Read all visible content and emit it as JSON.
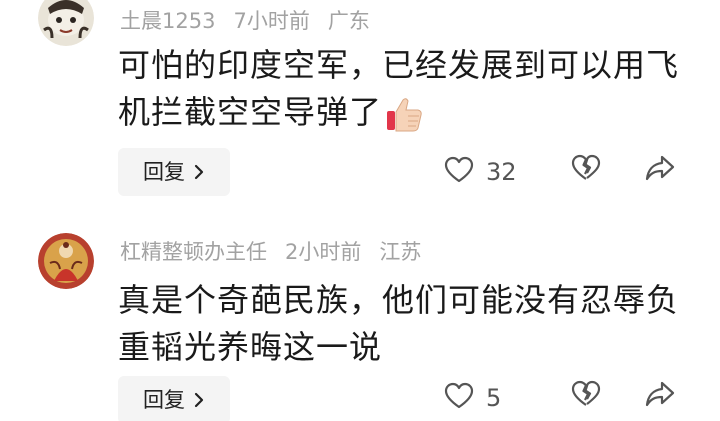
{
  "comments": [
    {
      "user": "土晨1253",
      "time": "7小时前",
      "location": "广东",
      "text": "可怕的印度空军，已经发展到可以用飞机拦截空空导弹了",
      "emoji": "thumbs-up",
      "reply_label": "回复",
      "likes": "32"
    },
    {
      "user": "杠精整顿办主任",
      "time": "2小时前",
      "location": "江苏",
      "text": "真是个奇葩民族，他们可能没有忍辱负重韬光养晦这一说",
      "reply_label": "回复",
      "likes": "5"
    }
  ],
  "icons": {
    "like": "heart-outline-icon",
    "dislike": "broken-heart-icon",
    "share": "share-arrow-icon",
    "chevron": "chevron-right-icon"
  },
  "colors": {
    "meta_text": "#a2a2a2",
    "body_text": "#1a1a1a",
    "reply_bg": "#f4f4f4",
    "icon": "#555555"
  }
}
